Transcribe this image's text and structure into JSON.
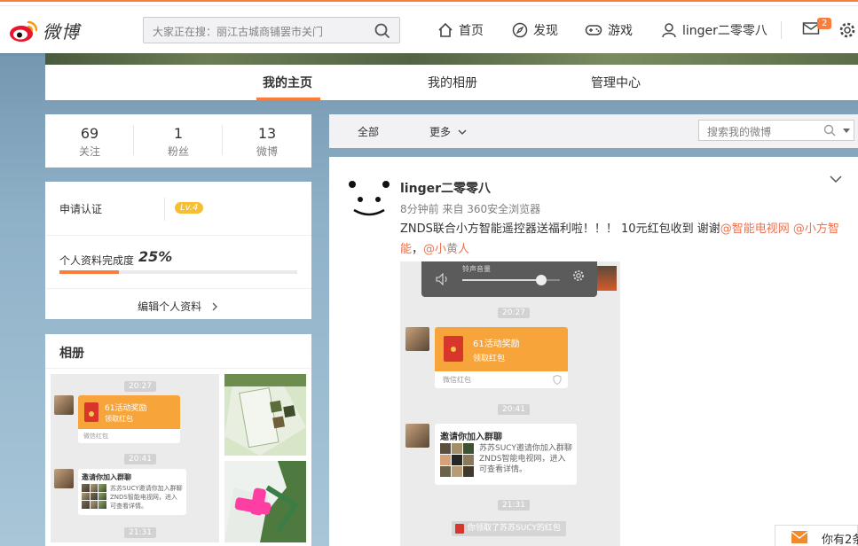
{
  "brand": {
    "name": "微博"
  },
  "search": {
    "placeholder": "大家正在搜：丽江古城商铺罢市关门"
  },
  "nav": {
    "home": "首页",
    "discover": "发现",
    "games": "游戏",
    "user": "linger二零零八",
    "message_count": "2"
  },
  "tabs": [
    "我的主页",
    "我的相册",
    "管理中心"
  ],
  "stats": [
    {
      "value": "69",
      "label": "关注"
    },
    {
      "value": "1",
      "label": "粉丝"
    },
    {
      "value": "13",
      "label": "微博"
    }
  ],
  "profile": {
    "verify_label": "申请认证",
    "level": "Lv.4",
    "completion_label": "个人资料完成度",
    "completion_value": "25%",
    "completion_fraction": 0.25,
    "edit_label": "编辑个人资料"
  },
  "album": {
    "title": "相册"
  },
  "feed_filter": {
    "all": "全部",
    "more": "更多",
    "search_placeholder": "搜索我的微博"
  },
  "post": {
    "author": "linger二零零八",
    "meta": "8分钟前 来自 360安全浏览器",
    "text_main": "ZNDS联合小方智能遥控器送福利啦！！！ 10元红包收到 谢谢",
    "mention1": "@智能电视网",
    "mention2": "@小方智能",
    "sep": "，",
    "mention3": "@小黄人"
  },
  "chat": {
    "volume_label": "铃声音量",
    "time1": "20:27",
    "time2": "20:41",
    "time3": "21:31",
    "packet_title": "61活动奖励",
    "packet_sub": "领取红包",
    "packet_footer": "微信红包",
    "invite_title": "邀请你加入群聊",
    "invite_body": "苏苏SUCY邀请你加入群聊ZNDS智能电视网，进入可查看详情。",
    "toast": "你领取了苏苏SUCY的红包"
  },
  "corner_popup": {
    "text": "你有2条"
  },
  "colors": {
    "accent": "#fa7d3c",
    "mention": "#eb7350",
    "packet": "#f7a43a",
    "level": "#f6be33"
  }
}
